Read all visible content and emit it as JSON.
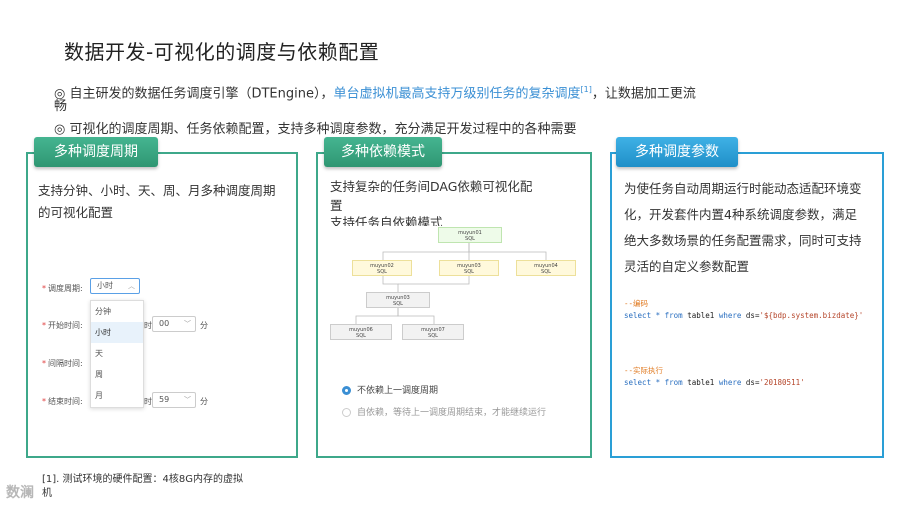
{
  "title": "数据开发-可视化的调度与依赖配置",
  "bullets": {
    "b1_prefix": "◎ 自主研发的数据任务调度引擎（DTEngine），",
    "b1_highlight": "单台虚拟机最高支持万级别任务的复杂调度",
    "b1_ref": "[1]",
    "b1_suffix": "，让数据加工更流",
    "b1_wrap": "畅",
    "b2": "◎ 可视化的调度周期、任务依赖配置，支持多种调度参数，充分满足开发过程中的各种需要"
  },
  "panels": {
    "p1": {
      "tab": "多种调度周期",
      "text1": "支持分钟、小时、天、周、月多种调度周期",
      "text2": "的可视化配置",
      "form": {
        "period_label": "调度周期:",
        "period_value": "小时",
        "start_label": "开始时间:",
        "start_hour_unit": "时",
        "start_min_value": "00",
        "start_min_unit": "分",
        "interval_label": "间隔时间:",
        "end_label": "结束时间:",
        "end_hour_unit": "时",
        "end_min_value": "59",
        "end_min_unit": "分",
        "options": [
          "分钟",
          "小时",
          "天",
          "周",
          "月"
        ]
      }
    },
    "p2": {
      "tab": "多种依赖模式",
      "text1": "支持复杂的任务间DAG依赖可视化配",
      "text2": "置",
      "text3": "支持任务自依赖模式",
      "nodes": {
        "n1_name": "muyun01",
        "n1_type": "SQL",
        "n2_name": "muyun02",
        "n2_type": "SQL",
        "n3_name": "muyun03",
        "n3_type": "SQL",
        "n4_name": "muyun04",
        "n4_type": "SQL",
        "n5_name": "muyun03",
        "n5_type": "SQL",
        "n6_name": "muyun06",
        "n6_type": "SQL",
        "n7_name": "muyun07",
        "n7_type": "SQL"
      },
      "radio1": "不依赖上一调度周期",
      "radio2": "自依赖，等待上一调度周期结束，才能继续运行"
    },
    "p3": {
      "tab": "多种调度参数",
      "lines": [
        "为使任务自动周期运行时能动态适配环境变",
        "化，开发套件内置4种系统调度参数，满足",
        "绝大多数场景的任务配置需求，同时可支持",
        "灵活的自定义参数配置"
      ],
      "code1_comment": "--编码",
      "code1_kw1": "select * from",
      "code1_mid": " table1 ",
      "code1_kw2": "where",
      "code1_rest": " ds=",
      "code1_str": "'${bdp.system.bizdate}'",
      "code2_comment": "--实际执行",
      "code2_kw1": "select * from",
      "code2_mid": " table1 ",
      "code2_kw2": "where",
      "code2_rest": " ds=",
      "code2_str": "'20180511'"
    }
  },
  "footnote_line1": "[1]. 测试环境的硬件配置：4核8G内存的虚拟",
  "footnote_line2": "机",
  "logo_text": "数澜"
}
